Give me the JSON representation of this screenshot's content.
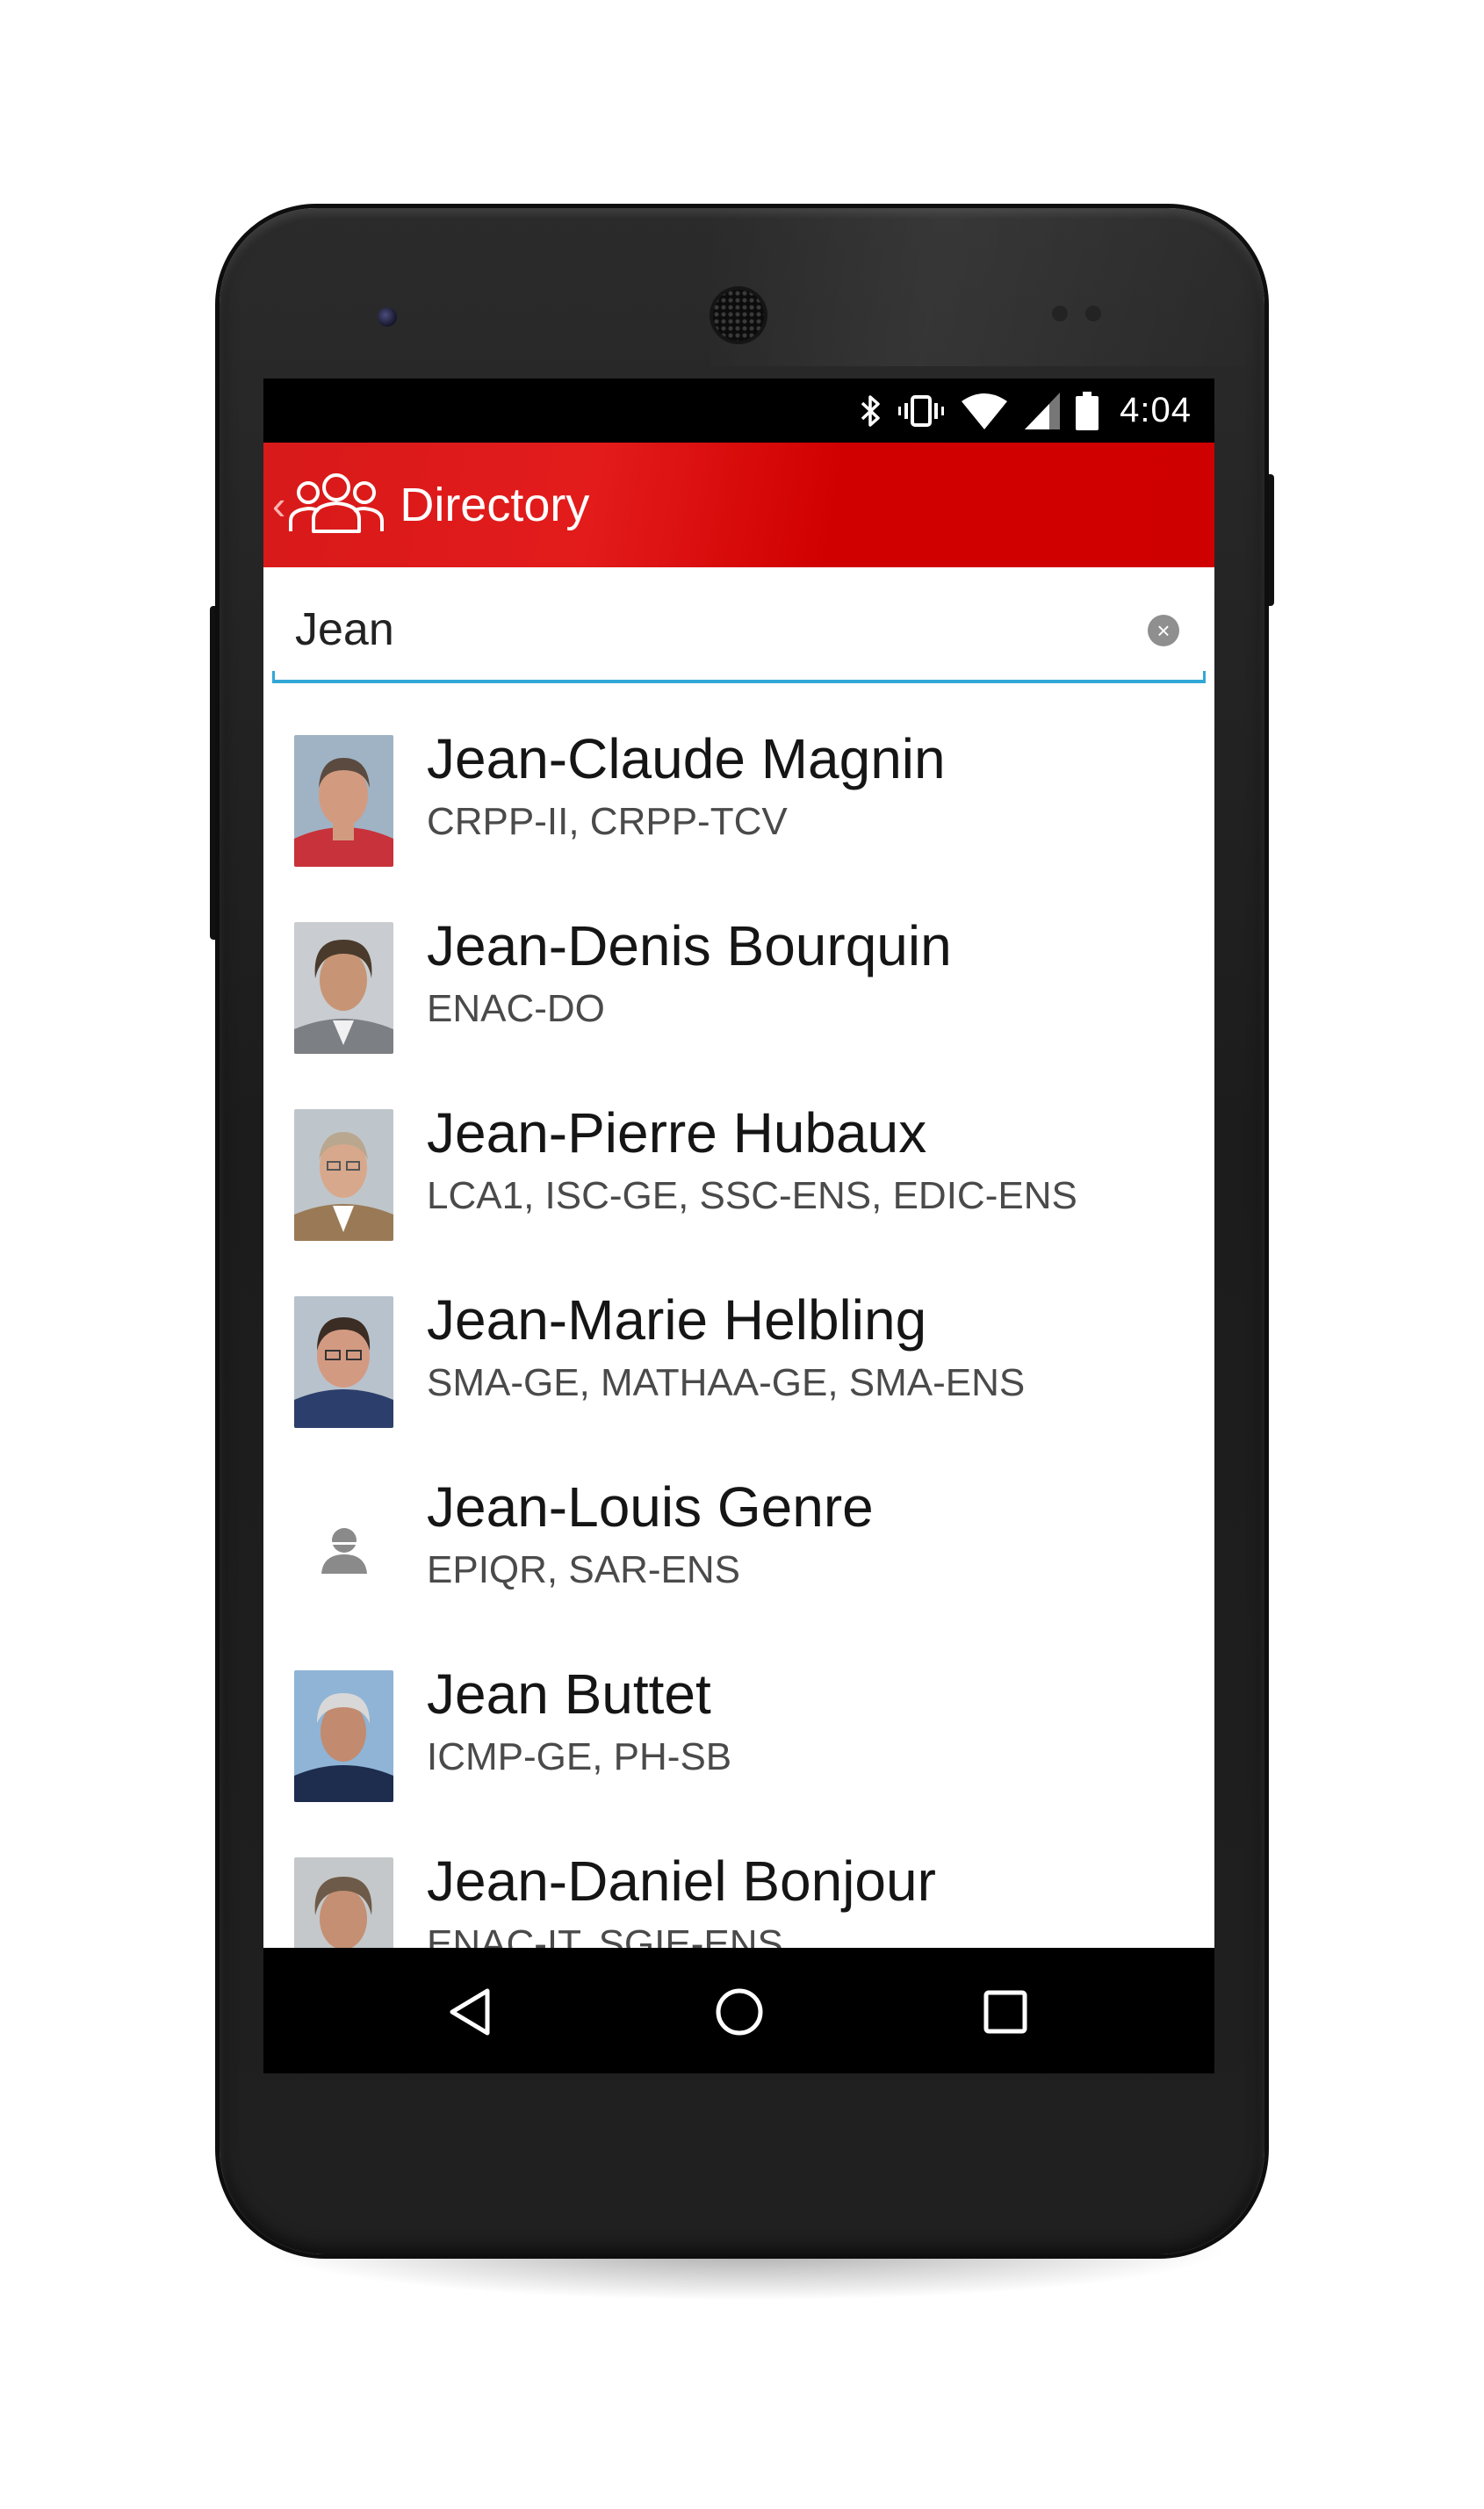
{
  "status_bar": {
    "time": "4:04",
    "icons": [
      "bluetooth-icon",
      "vibrate-icon",
      "wifi-icon",
      "signal-icon",
      "battery-icon"
    ]
  },
  "app_bar": {
    "title": "Directory",
    "back_glyph": "‹",
    "icon": "people-icon",
    "background_color": "#d81a1a"
  },
  "search": {
    "value": "Jean",
    "clear_icon": "clear-icon",
    "accent_color": "#33a7d6"
  },
  "results": [
    {
      "name": "Jean-Claude Magnin",
      "units": "CRPP-II, CRPP-TCV",
      "has_photo": true
    },
    {
      "name": "Jean-Denis Bourquin",
      "units": "ENAC-DO",
      "has_photo": true
    },
    {
      "name": "Jean-Pierre Hubaux",
      "units": "LCA1, ISC-GE, SSC-ENS, EDIC-ENS",
      "has_photo": true
    },
    {
      "name": "Jean-Marie Helbling",
      "units": "SMA-GE, MATHAA-GE, SMA-ENS",
      "has_photo": true
    },
    {
      "name": "Jean-Louis Genre",
      "units": "EPIQR, SAR-ENS",
      "has_photo": false
    },
    {
      "name": "Jean Buttet",
      "units": "ICMP-GE, PH-SB",
      "has_photo": true
    },
    {
      "name": "Jean-Daniel Bonjour",
      "units": "ENAC-IT, SGIE-ENS",
      "has_photo": true
    }
  ],
  "nav_bar": {
    "buttons": [
      "back-triangle-icon",
      "home-circle-icon",
      "recents-square-icon"
    ]
  }
}
